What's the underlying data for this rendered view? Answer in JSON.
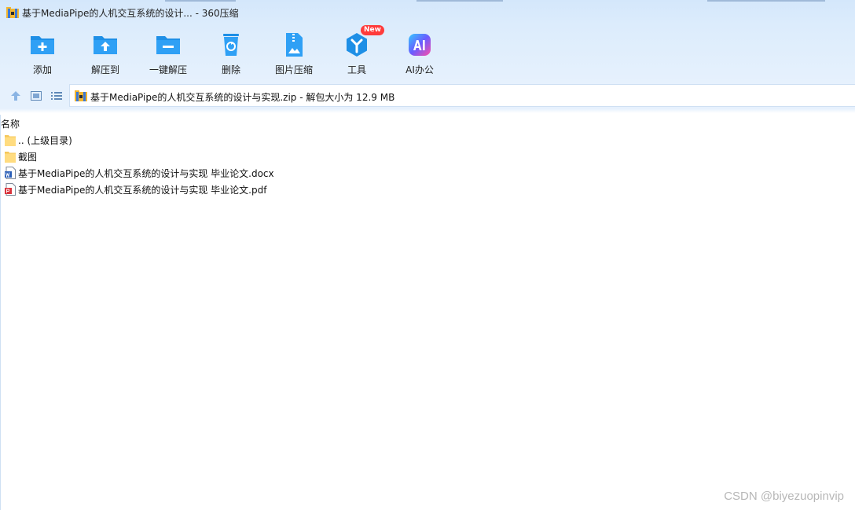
{
  "window": {
    "title": "基于MediaPipe的人机交互系统的设计... - 360压缩"
  },
  "toolbar": {
    "items": [
      {
        "label": "添加",
        "icon": "folder-add-icon"
      },
      {
        "label": "解压到",
        "icon": "folder-extract-icon"
      },
      {
        "label": "一键解压",
        "icon": "folder-oneclick-extract-icon"
      },
      {
        "label": "删除",
        "icon": "recycle-bin-icon"
      },
      {
        "label": "图片压缩",
        "icon": "image-compress-icon"
      },
      {
        "label": "工具",
        "icon": "tools-icon",
        "badge": "New"
      },
      {
        "label": "AI办公",
        "icon": "ai-office-icon"
      }
    ]
  },
  "navbar": {
    "path": "基于MediaPipe的人机交互系统的设计与实现.zip - 解包大小为 12.9 MB"
  },
  "list": {
    "column_name": "名称",
    "rows": [
      {
        "name": ".. (上级目录)",
        "type": "folder"
      },
      {
        "name": "截图",
        "type": "folder"
      },
      {
        "name": "基于MediaPipe的人机交互系统的设计与实现 毕业论文.docx",
        "type": "word"
      },
      {
        "name": "基于MediaPipe的人机交互系统的设计与实现 毕业论文.pdf",
        "type": "pdf"
      }
    ]
  },
  "watermark": "CSDN @biyezuopinvip",
  "colors": {
    "accent": "#1e8fe6",
    "header_bg": "#dcecfc",
    "badge": "#ff3b3b"
  }
}
